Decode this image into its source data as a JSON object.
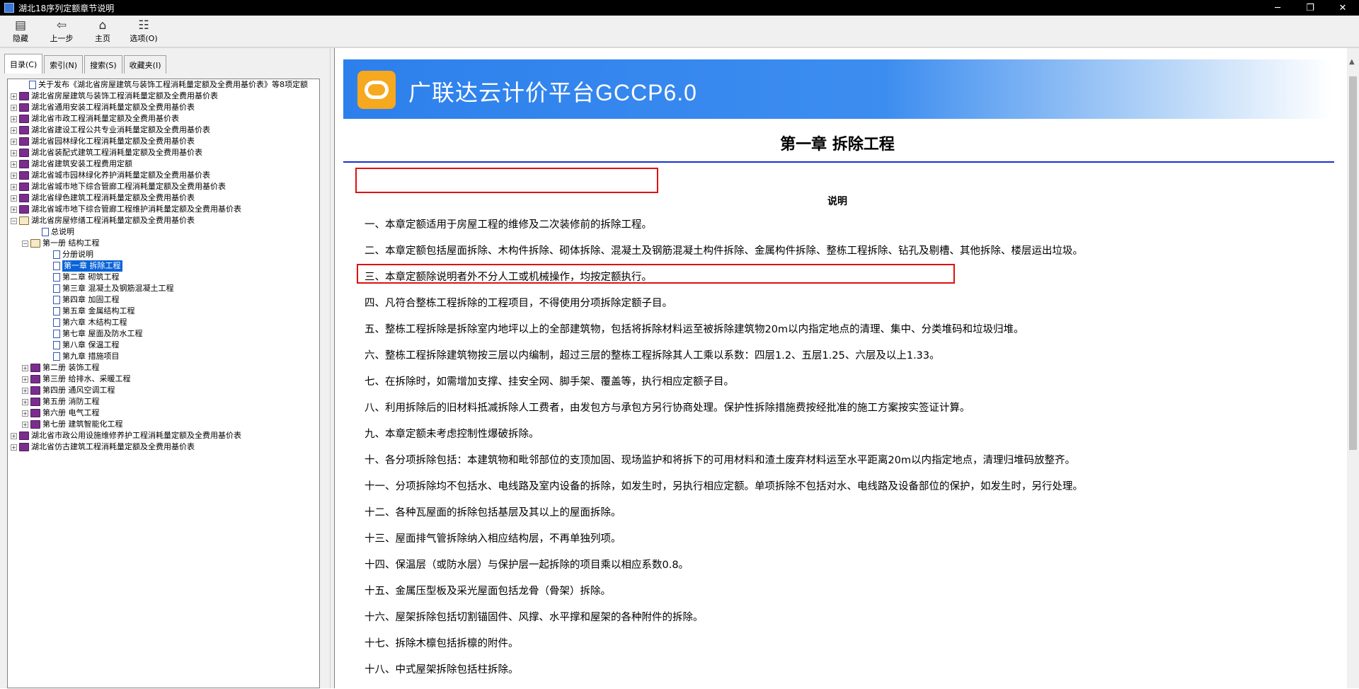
{
  "window": {
    "title": "湖北18序列定额章节说明",
    "min": "─",
    "restore": "❐",
    "close": "✕"
  },
  "toolbar": {
    "hide": "隐藏",
    "back": "上一步",
    "home": "主页",
    "options": "选项(O)",
    "icons": [
      "hide-icon",
      "back-arrow-icon",
      "home-icon",
      "options-icon"
    ]
  },
  "tabs": [
    "目录(C)",
    "索引(N)",
    "搜索(S)",
    "收藏夹(I)"
  ],
  "tree": [
    {
      "label": "关于发布《湖北省房屋建筑与装饰工程消耗量定额及全费用基价表》等8项定额",
      "icon": "page",
      "exp": "",
      "level": 1
    },
    {
      "label": "湖北省房屋建筑与装饰工程消耗量定额及全费用基价表",
      "icon": "book",
      "exp": "+",
      "level": 0
    },
    {
      "label": "湖北省通用安装工程消耗量定额及全费用基价表",
      "icon": "book",
      "exp": "+",
      "level": 0
    },
    {
      "label": "湖北省市政工程消耗量定额及全费用基价表",
      "icon": "book",
      "exp": "+",
      "level": 0
    },
    {
      "label": "湖北省建设工程公共专业消耗量定额及全费用基价表",
      "icon": "book",
      "exp": "+",
      "level": 0
    },
    {
      "label": "湖北省园林绿化工程消耗量定额及全费用基价表",
      "icon": "book",
      "exp": "+",
      "level": 0
    },
    {
      "label": "湖北省装配式建筑工程消耗量定额及全费用基价表",
      "icon": "book",
      "exp": "+",
      "level": 0
    },
    {
      "label": "湖北省建筑安装工程费用定额",
      "icon": "book",
      "exp": "+",
      "level": 0
    },
    {
      "label": "湖北省城市园林绿化养护消耗量定额及全费用基价表",
      "icon": "book",
      "exp": "+",
      "level": 0
    },
    {
      "label": "湖北省城市地下综合管廊工程消耗量定额及全费用基价表",
      "icon": "book",
      "exp": "+",
      "level": 0
    },
    {
      "label": "湖北省绿色建筑工程消耗量定额及全费用基价表",
      "icon": "book",
      "exp": "+",
      "level": 0
    },
    {
      "label": "湖北省城市地下综合管廊工程维护消耗量定额及全费用基价表",
      "icon": "book",
      "exp": "+",
      "level": 0
    },
    {
      "label": "湖北省房屋修缮工程消耗量定额及全费用基价表",
      "icon": "book-open",
      "exp": "−",
      "level": 0
    },
    {
      "label": "总说明",
      "icon": "page",
      "exp": "",
      "level": 2
    },
    {
      "label": "第一册 结构工程",
      "icon": "book-open",
      "exp": "−",
      "level": 1
    },
    {
      "label": "分册说明",
      "icon": "page",
      "exp": "",
      "level": 3
    },
    {
      "label": "第一章 拆除工程",
      "icon": "page",
      "exp": "",
      "level": 3,
      "selected": true
    },
    {
      "label": "第二章 砌筑工程",
      "icon": "page",
      "exp": "",
      "level": 3
    },
    {
      "label": "第三章 混凝土及钢筋混凝土工程",
      "icon": "page",
      "exp": "",
      "level": 3
    },
    {
      "label": "第四章 加固工程",
      "icon": "page",
      "exp": "",
      "level": 3
    },
    {
      "label": "第五章 金属结构工程",
      "icon": "page",
      "exp": "",
      "level": 3
    },
    {
      "label": "第六章 木结构工程",
      "icon": "page",
      "exp": "",
      "level": 3
    },
    {
      "label": "第七章 屋面及防水工程",
      "icon": "page",
      "exp": "",
      "level": 3
    },
    {
      "label": "第八章 保温工程",
      "icon": "page",
      "exp": "",
      "level": 3
    },
    {
      "label": "第九章 措施项目",
      "icon": "page",
      "exp": "",
      "level": 3
    },
    {
      "label": "第二册 装饰工程",
      "icon": "book",
      "exp": "+",
      "level": 1
    },
    {
      "label": "第三册 给排水、采暖工程",
      "icon": "book",
      "exp": "+",
      "level": 1
    },
    {
      "label": "第四册 通风空调工程",
      "icon": "book",
      "exp": "+",
      "level": 1
    },
    {
      "label": "第五册 消防工程",
      "icon": "book",
      "exp": "+",
      "level": 1
    },
    {
      "label": "第六册 电气工程",
      "icon": "book",
      "exp": "+",
      "level": 1
    },
    {
      "label": "第七册 建筑智能化工程",
      "icon": "book",
      "exp": "+",
      "level": 1
    },
    {
      "label": "湖北省市政公用设施维修养护工程消耗量定额及全费用基价表",
      "icon": "book",
      "exp": "+",
      "level": 0
    },
    {
      "label": "湖北省仿古建筑工程消耗量定额及全费用基价表",
      "icon": "book",
      "exp": "+",
      "level": 0
    }
  ],
  "content": {
    "banner_title": "广联达云计价平台GCCP6.0",
    "chapter_title": "第一章 拆除工程",
    "section_title": "说明",
    "items": [
      "一、本章定额适用于房屋工程的维修及二次装修前的拆除工程。",
      "二、本章定额包括屋面拆除、木构件拆除、砌体拆除、混凝土及钢筋混凝土构件拆除、金属构件拆除、整栋工程拆除、钻孔及剔槽、其他拆除、楼层运出垃圾。",
      "三、本章定额除说明者外不分人工或机械操作，均按定额执行。",
      "四、凡符合整栋工程拆除的工程项目，不得使用分项拆除定额子目。",
      "五、整栋工程拆除是拆除室内地坪以上的全部建筑物，包括将拆除材料运至被拆除建筑物20m以内指定地点的清理、集中、分类堆码和垃圾归堆。",
      "六、整栋工程拆除建筑物按三层以内编制，超过三层的整栋工程拆除其人工乘以系数：四层1.2、五层1.25、六层及以上1.33。",
      "七、在拆除时，如需增加支撑、挂安全网、脚手架、覆盖等，执行相应定额子目。",
      "八、利用拆除后的旧材料抵减拆除人工费者，由发包方与承包方另行协商处理。保护性拆除措施费按经批准的施工方案按实签证计算。",
      "九、本章定额未考虑控制性爆破拆除。",
      "十、各分项拆除包括：本建筑物和毗邻部位的支顶加固、现场监护和将拆下的可用材料和渣土废弃材料运至水平距离20m以内指定地点，清理归堆码放整齐。",
      "十一、分项拆除均不包括水、电线路及室内设备的拆除，如发生时，另执行相应定额。单项拆除不包括对水、电线路及设备部位的保护，如发生时，另行处理。",
      "十二、各种瓦屋面的拆除包括基层及其以上的屋面拆除。",
      "十三、屋面排气管拆除纳入相应结构层，不再单独列项。",
      "十四、保温层（或防水层）与保护层一起拆除的项目乘以相应系数0.8。",
      "十五、金属压型板及采光屋面包括龙骨（骨架）拆除。",
      "十六、屋架拆除包括切割锚固件、风撑、水平撑和屋架的各种附件的拆除。",
      "十七、拆除木檩包括拆檩的附件。",
      "十八、中式屋架拆除包括柱拆除。"
    ]
  },
  "colors": {
    "highlight": "#e01010",
    "banner": "#2d80ec",
    "logo": "#f6a81e",
    "rule": "#1a2fd0",
    "selection": "#0a64d8"
  }
}
